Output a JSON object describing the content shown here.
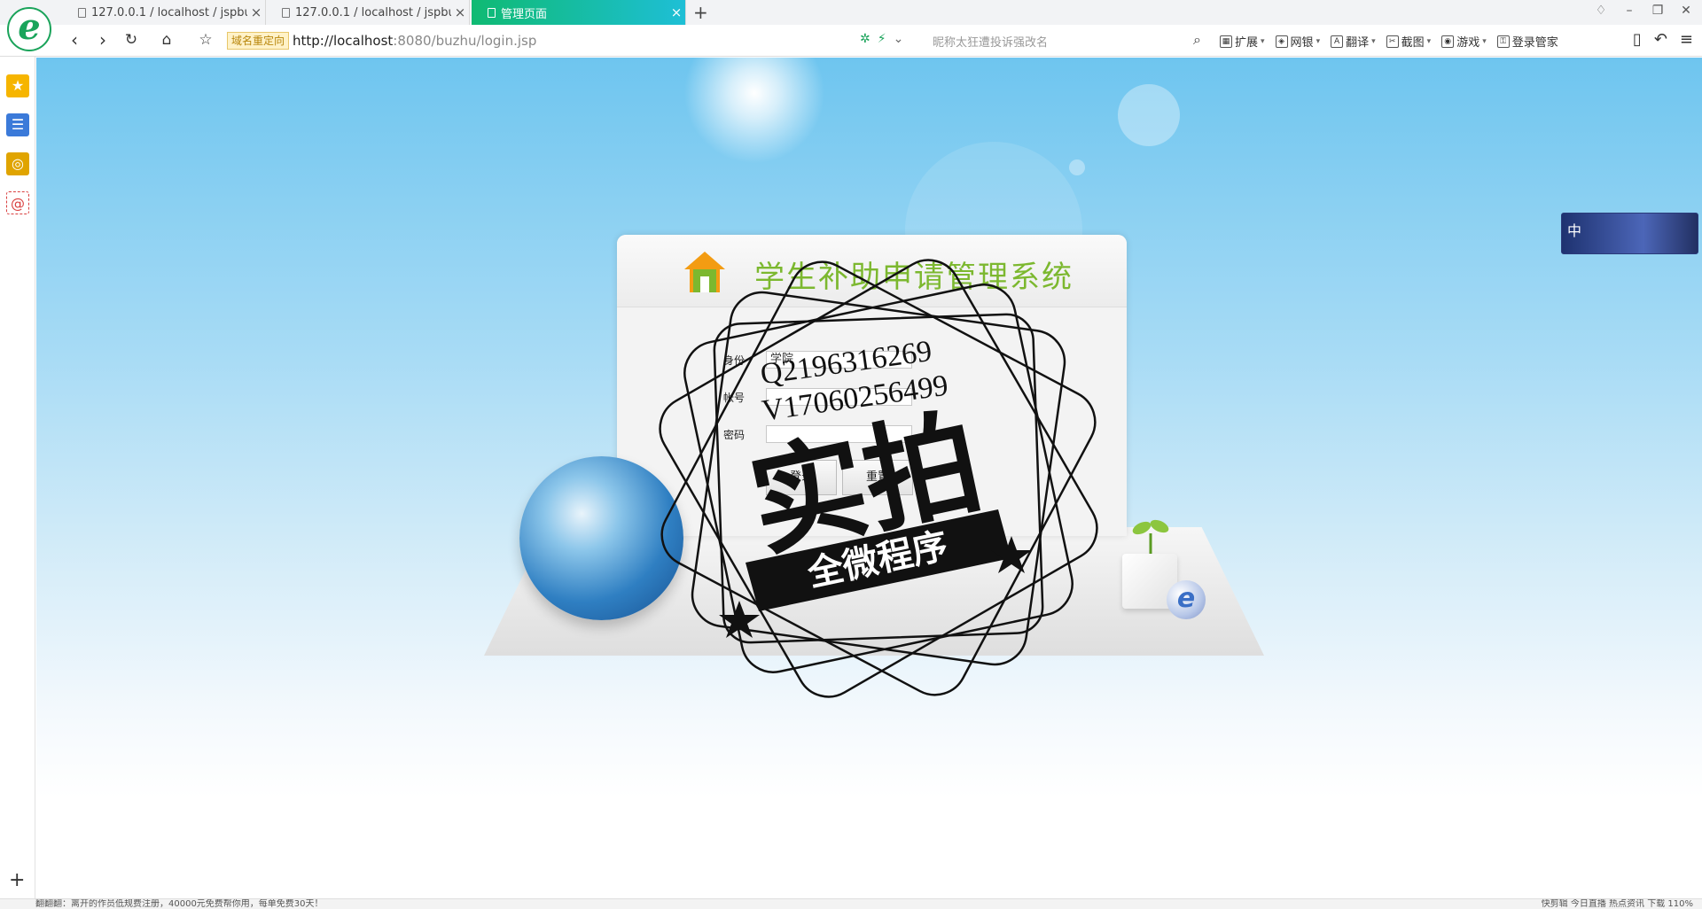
{
  "browser": {
    "tabs": [
      {
        "title": "127.0.0.1 / localhost / jspbuzhu",
        "active": false
      },
      {
        "title": "127.0.0.1 / localhost / jspbuzhu",
        "active": false
      },
      {
        "title": "管理页面",
        "active": true
      }
    ],
    "new_tab_icon": "plus-icon",
    "redirect_badge": "域名重定向",
    "url_host": "http://localhost",
    "url_rest": ":8080/buzhu/login.jsp",
    "search_placeholder": "昵称太狂遭投诉强改名",
    "toolbar": [
      {
        "label": "扩展",
        "icon": "grid-icon"
      },
      {
        "label": "网银",
        "icon": "shield-icon"
      },
      {
        "label": "翻译",
        "icon": "translate-icon"
      },
      {
        "label": "截图",
        "icon": "scissors-icon"
      },
      {
        "label": "游戏",
        "icon": "gamepad-icon"
      },
      {
        "label": "登录管家",
        "icon": "key-icon"
      }
    ],
    "accent": "#16b9c2"
  },
  "sidebar": {
    "items": [
      {
        "name": "favorites",
        "icon": "star-icon",
        "color": "#f6b500"
      },
      {
        "name": "apps",
        "icon": "list-icon",
        "color": "#3b7ad9"
      },
      {
        "name": "weibo",
        "icon": "weibo-icon",
        "color": "#e0a400"
      },
      {
        "name": "mail",
        "icon": "mail-icon",
        "color": "#d94040"
      }
    ]
  },
  "login": {
    "system_title": "学生补助申请管理系统",
    "role_label": "身份",
    "role_value": "学院",
    "account_label": "帐号",
    "password_label": "密码",
    "login_button": "登录",
    "reset_button": "重置"
  },
  "watermark": {
    "line1": "Q2196316269",
    "line2": "V17060256499",
    "big_text": "实拍",
    "ribbon_text": "全微程序"
  },
  "ime": {
    "label": "中"
  },
  "status": {
    "left_text": "翻翻翻：离开的作员低规费注册，40000元免费帮你用，每单免费30天！",
    "right_text": "快剪辑   今日直播   热点资讯   下载   110%"
  }
}
